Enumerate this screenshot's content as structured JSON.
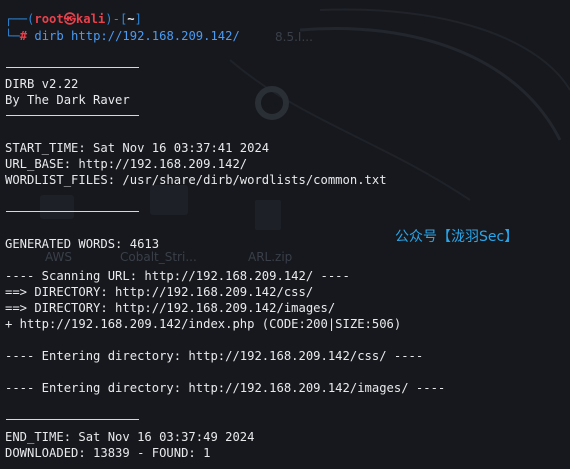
{
  "prompt": {
    "user": "root",
    "host": "kali",
    "cwd": "~",
    "symbol": "#",
    "command": "dirb http://192.168.209.142/"
  },
  "banner": {
    "version": "DIRB v2.22",
    "author": "By The Dark Raver"
  },
  "info": {
    "start_time": "START_TIME: Sat Nov 16 03:37:41 2024",
    "url_base": "URL_BASE: http://192.168.209.142/",
    "wordlist": "WORDLIST_FILES: /usr/share/dirb/wordlists/common.txt"
  },
  "generated": "GENERATED WORDS: 4613",
  "scan": {
    "scanning": "---- Scanning URL: http://192.168.209.142/ ----",
    "dir1": "==> DIRECTORY: http://192.168.209.142/css/",
    "dir2": "==> DIRECTORY: http://192.168.209.142/images/",
    "file1": "+ http://192.168.209.142/index.php (CODE:200|SIZE:506)",
    "enter1": "---- Entering directory: http://192.168.209.142/css/ ----",
    "enter2": "---- Entering directory: http://192.168.209.142/images/ ----"
  },
  "footer": {
    "end_time": "END_TIME: Sat Nov 16 03:37:49 2024",
    "downloaded": "DOWNLOADED: 13839 - FOUND: 1"
  },
  "watermark": "公众号【泷羽Sec】",
  "desktop": {
    "icon1_label": "AWS",
    "icon2_label": "Cobalt_Stri...",
    "icon3_label": "ARL.zip",
    "ip_fragment": "8.5.I..."
  }
}
